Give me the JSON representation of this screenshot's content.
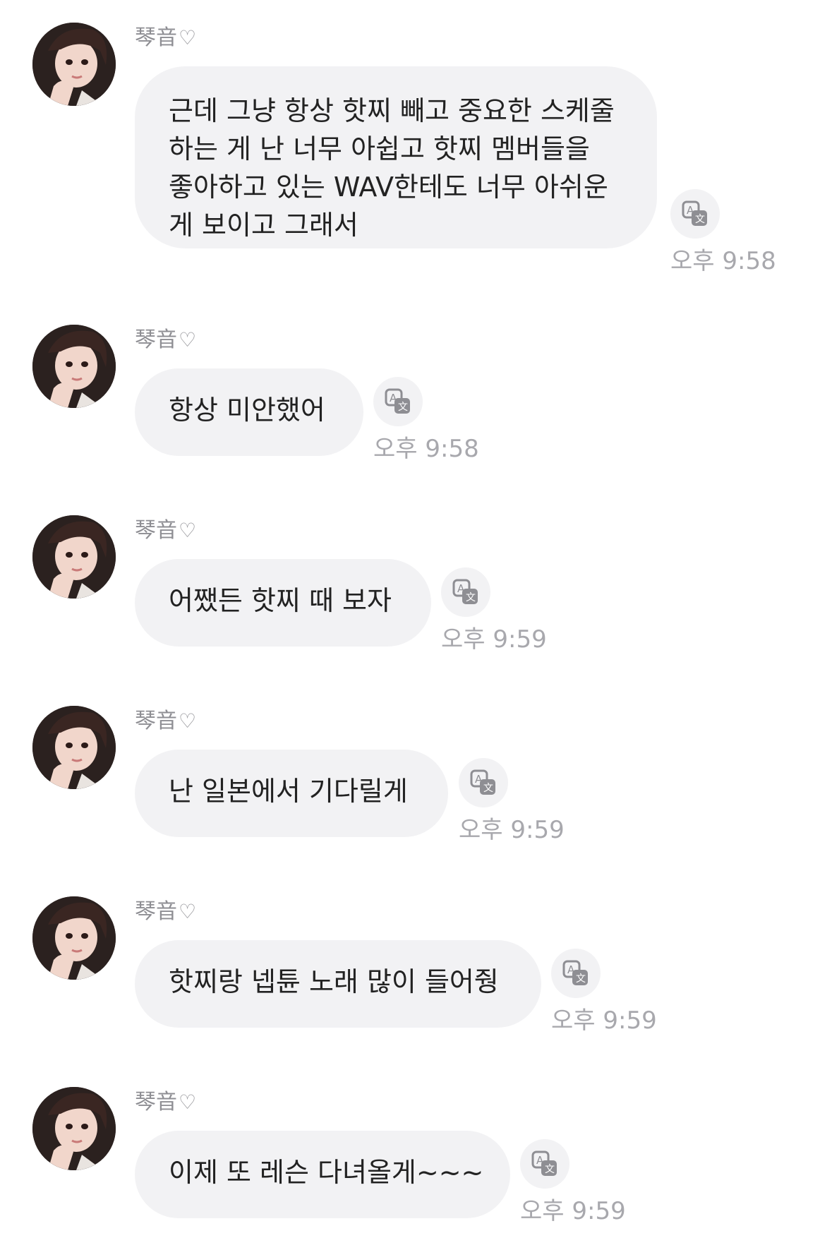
{
  "messages": [
    {
      "sender": "琴音",
      "heart": "♡",
      "text": "근데 그냥 항상 핫찌 빼고 중요한 스케줄 하는 게 난 너무 아쉽고 핫찌 멤버들을 좋아하고 있는 WAV한테도 너무 아쉬운 게 보이고 그래서",
      "time": "오후 9:58",
      "translate_icon": "translate-icon"
    },
    {
      "sender": "琴音",
      "heart": "♡",
      "text": "항상 미안했어",
      "time": "오후 9:58",
      "translate_icon": "translate-icon"
    },
    {
      "sender": "琴音",
      "heart": "♡",
      "text": "어쨌든 핫찌 때 보자",
      "time": "오후 9:59",
      "translate_icon": "translate-icon"
    },
    {
      "sender": "琴音",
      "heart": "♡",
      "text": "난 일본에서 기다릴게",
      "time": "오후 9:59",
      "translate_icon": "translate-icon"
    },
    {
      "sender": "琴音",
      "heart": "♡",
      "text": "핫찌랑 넵튠 노래 많이 들어줭",
      "time": "오후 9:59",
      "translate_icon": "translate-icon"
    },
    {
      "sender": "琴音",
      "heart": "♡",
      "text": "이제 또 레슨 다녀올게~~~",
      "time": "오후 9:59",
      "translate_icon": "translate-icon"
    }
  ],
  "colors": {
    "bubble": "#f2f2f4",
    "text": "#222222",
    "name": "#8e8e93",
    "time": "#a8a8ad",
    "background": "#ffffff"
  }
}
